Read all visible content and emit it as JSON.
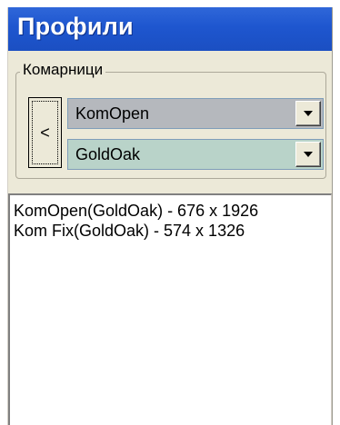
{
  "window": {
    "title": "Профили"
  },
  "group": {
    "label": "Комарници"
  },
  "nav_button": {
    "label": "<"
  },
  "combos": [
    {
      "value": "KomOpen",
      "icon": "chevron-down-icon"
    },
    {
      "value": "GoldOak",
      "icon": "chevron-down-icon"
    }
  ],
  "list": {
    "items": [
      "KomOpen(GoldOak) - 676 x 1926",
      "Kom Fix(GoldOak) - 574 x 1326"
    ]
  },
  "colors": {
    "title_bar": "#1e56cf",
    "panel": "#ece9d8",
    "combo1_bg": "#b5b8bd",
    "combo2_bg": "#b9d3c9"
  }
}
